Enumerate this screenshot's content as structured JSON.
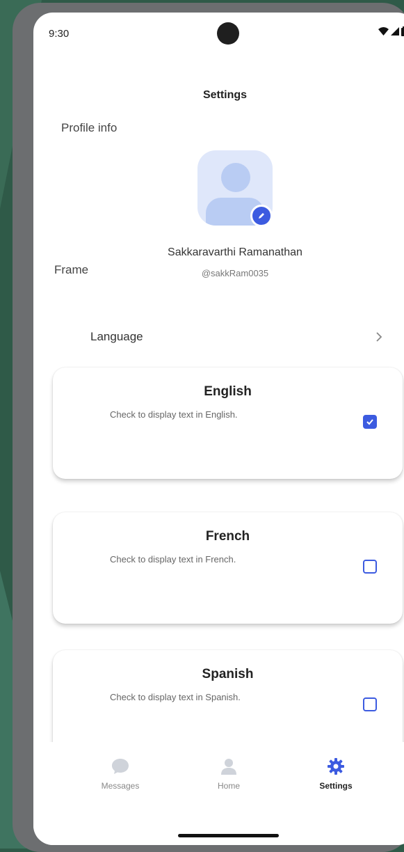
{
  "status_bar": {
    "time": "9:30"
  },
  "header": {
    "title": "Settings"
  },
  "profile": {
    "section_label": "Profile info",
    "frame_label": "Frame",
    "name": "Sakkaravarthi Ramanathan",
    "handle": "@sakkRam0035"
  },
  "language": {
    "label": "Language",
    "options": [
      {
        "title": "English",
        "description": "Check to display text in English.",
        "checked": true
      },
      {
        "title": "French",
        "description": "Check to display text in French.",
        "checked": false
      },
      {
        "title": "Spanish",
        "description": "Check to display text in Spanish.",
        "checked": false
      }
    ]
  },
  "bottom_nav": {
    "items": [
      {
        "label": "Messages",
        "icon": "chat-bubble-icon",
        "active": false
      },
      {
        "label": "Home",
        "icon": "person-icon",
        "active": false
      },
      {
        "label": "Settings",
        "icon": "gear-icon",
        "active": true
      }
    ]
  },
  "colors": {
    "accent": "#3c5be0",
    "avatar_bg": "#dfe7fa",
    "background": "#2f5a48"
  }
}
